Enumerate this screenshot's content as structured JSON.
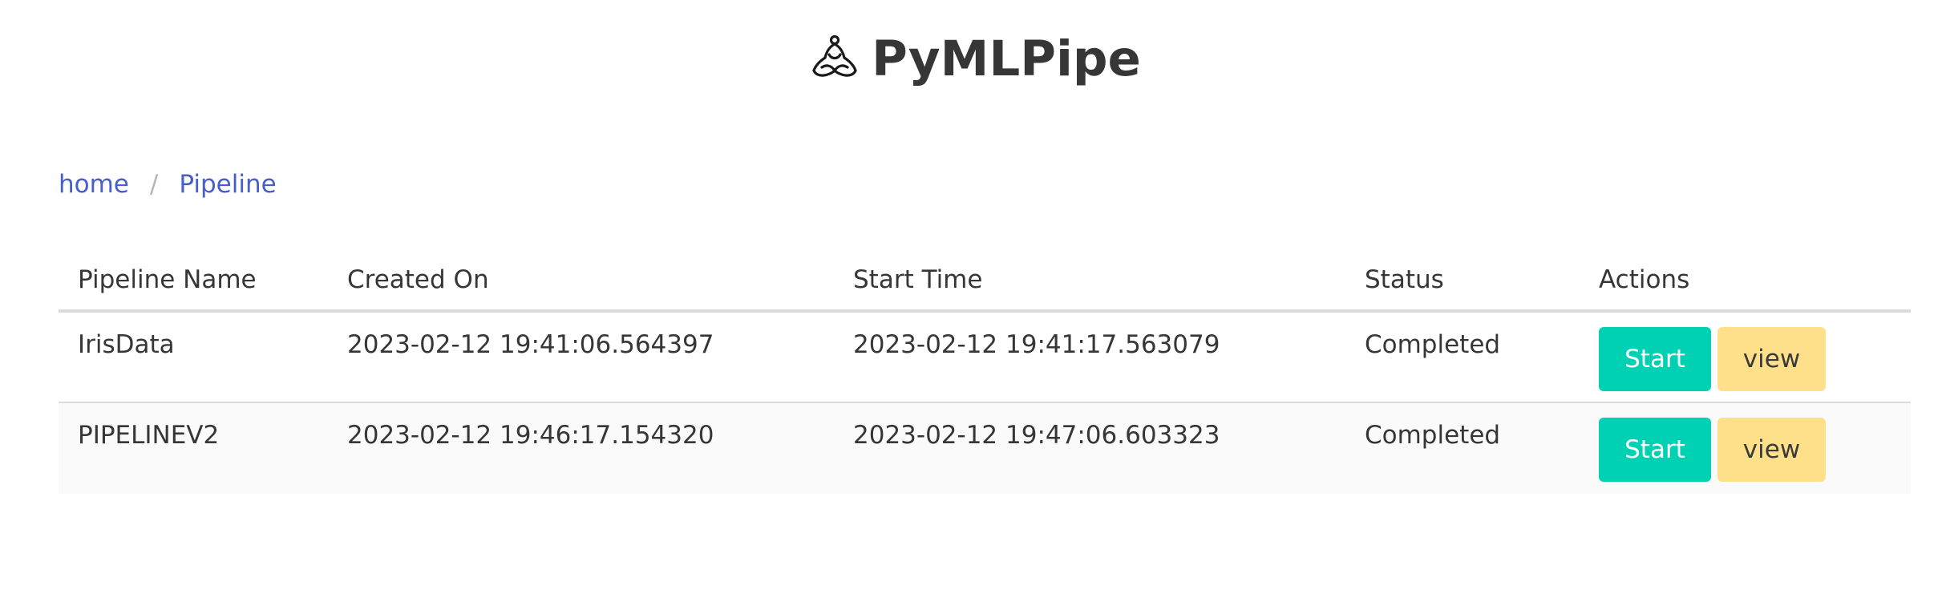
{
  "header": {
    "title": "PyMLPipe",
    "logo_icon": "meditation-icon"
  },
  "breadcrumb": {
    "items": [
      {
        "label": "home"
      },
      {
        "label": "Pipeline"
      }
    ],
    "separator": "/"
  },
  "table": {
    "columns": [
      "Pipeline Name",
      "Created On",
      "Start Time",
      "Status",
      "Actions"
    ],
    "rows": [
      {
        "name": "IrisData",
        "created_on": "2023-02-12 19:41:06.564397",
        "start_time": "2023-02-12 19:41:17.563079",
        "status": "Completed",
        "start_label": "Start",
        "view_label": "view"
      },
      {
        "name": "PIPELINEV2",
        "created_on": "2023-02-12 19:46:17.154320",
        "start_time": "2023-02-12 19:47:06.603323",
        "status": "Completed",
        "start_label": "Start",
        "view_label": "view"
      }
    ]
  },
  "colors": {
    "link": "#485fc7",
    "start_button": "#00d1b2",
    "view_button": "#ffe08a",
    "text": "#363636"
  }
}
